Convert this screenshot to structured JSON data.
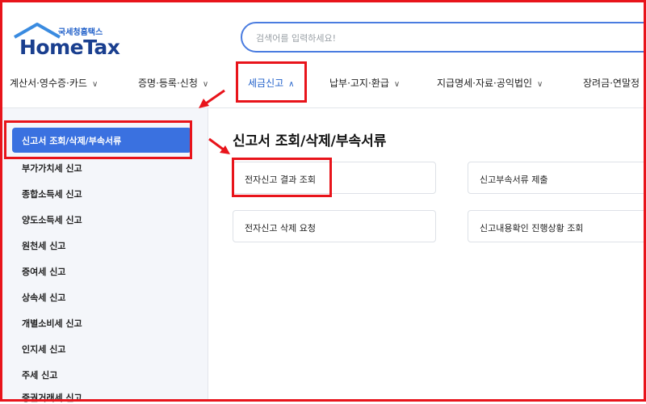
{
  "logo": {
    "subtitle": "국세청홈택스",
    "title": "HomeTax"
  },
  "search": {
    "placeholder": "검색어를 입력하세요!"
  },
  "nav": {
    "items": [
      {
        "label": "계산서·영수증·카드"
      },
      {
        "label": "증명·등록·신청"
      },
      {
        "label": "세금신고"
      },
      {
        "label": "납부·고지·환급"
      },
      {
        "label": "지급명세·자료·공익법인"
      },
      {
        "label": "장려금·연말정"
      }
    ],
    "active_index": 2
  },
  "sidebar": {
    "active": "신고서 조회/삭제/부속서류",
    "items": [
      {
        "label": "부가가치세 신고"
      },
      {
        "label": "종합소득세 신고"
      },
      {
        "label": "양도소득세 신고"
      },
      {
        "label": "원천세 신고"
      },
      {
        "label": "증여세 신고"
      },
      {
        "label": "상속세 신고"
      },
      {
        "label": "개별소비세 신고"
      },
      {
        "label": "인지세 신고"
      },
      {
        "label": "주세 신고"
      },
      {
        "label": "증권거래세 신고"
      }
    ]
  },
  "main": {
    "title": "신고서 조회/삭제/부속서류",
    "cards": [
      {
        "label": "전자신고 결과 조회"
      },
      {
        "label": "신고부속서류 제출"
      },
      {
        "label": "전자신고 삭제 요청"
      },
      {
        "label": "신고내용확인 진행상황 조회"
      }
    ]
  },
  "colors": {
    "accent": "#3a71e0",
    "highlight": "#e8141b",
    "logo": "#1a3f8f"
  }
}
